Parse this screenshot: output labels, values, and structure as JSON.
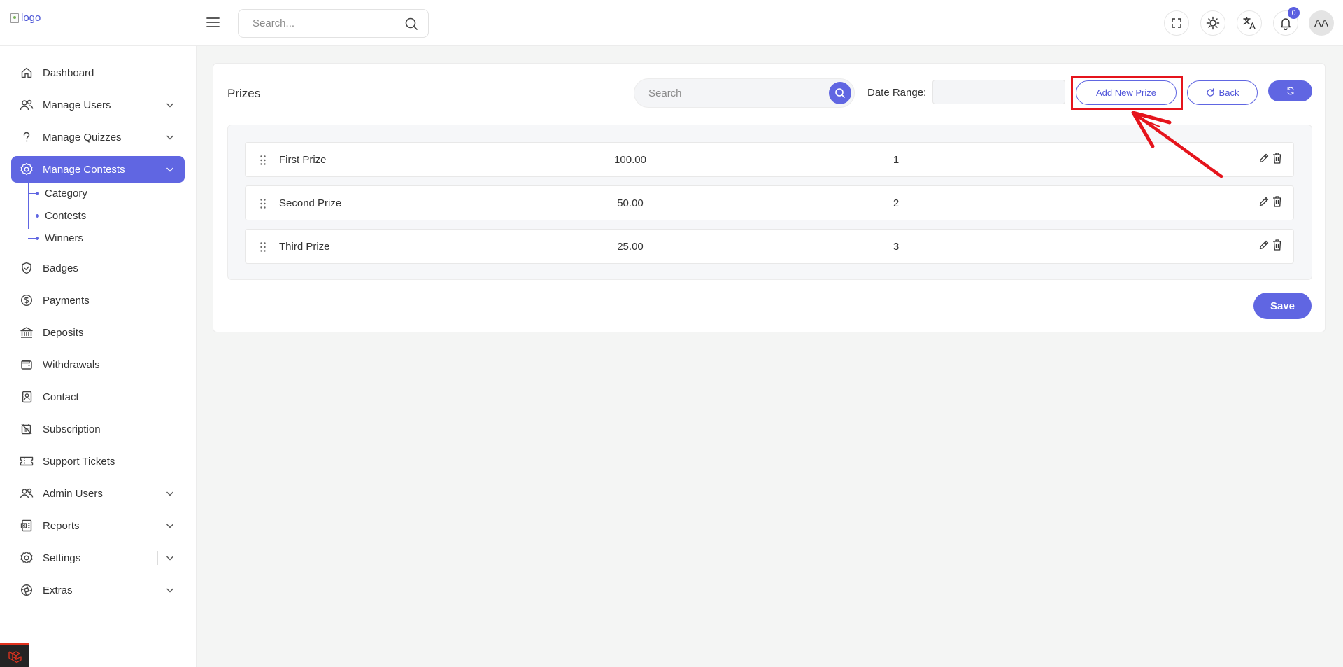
{
  "header": {
    "logo_alt": "logo",
    "search_placeholder": "Search...",
    "notification_count": "0",
    "avatar_initials": "AA"
  },
  "sidebar": {
    "items": [
      {
        "label": "Dashboard",
        "icon": "home-icon"
      },
      {
        "label": "Manage Users",
        "icon": "users-icon"
      },
      {
        "label": "Manage Quizzes",
        "icon": "question-icon"
      },
      {
        "label": "Manage Contests",
        "icon": "gear-badge-icon"
      },
      {
        "label": "Badges",
        "icon": "shield-check-icon"
      },
      {
        "label": "Payments",
        "icon": "dollar-circle-icon"
      },
      {
        "label": "Deposits",
        "icon": "bank-icon"
      },
      {
        "label": "Withdrawals",
        "icon": "wallet-icon"
      },
      {
        "label": "Contact",
        "icon": "contact-book-icon"
      },
      {
        "label": "Subscription",
        "icon": "subscription-icon"
      },
      {
        "label": "Support Tickets",
        "icon": "ticket-icon"
      },
      {
        "label": "Admin Users",
        "icon": "users-icon"
      },
      {
        "label": "Reports",
        "icon": "report-icon"
      },
      {
        "label": "Settings",
        "icon": "gear-icon"
      },
      {
        "label": "Extras",
        "icon": "aperture-icon"
      }
    ],
    "contest_subitems": [
      "Category",
      "Contests",
      "Winners"
    ]
  },
  "main": {
    "title": "Prizes",
    "search_placeholder": "Search",
    "date_range_label": "Date Range:",
    "add_button": "Add New Prize",
    "back_button": "Back",
    "save_button": "Save",
    "prizes": [
      {
        "name": "First Prize",
        "amount": "100.00",
        "rank": "1"
      },
      {
        "name": "Second Prize",
        "amount": "50.00",
        "rank": "2"
      },
      {
        "name": "Third Prize",
        "amount": "25.00",
        "rank": "3"
      }
    ]
  },
  "colors": {
    "accent": "#6066e2",
    "annotation": "#e5141c"
  }
}
